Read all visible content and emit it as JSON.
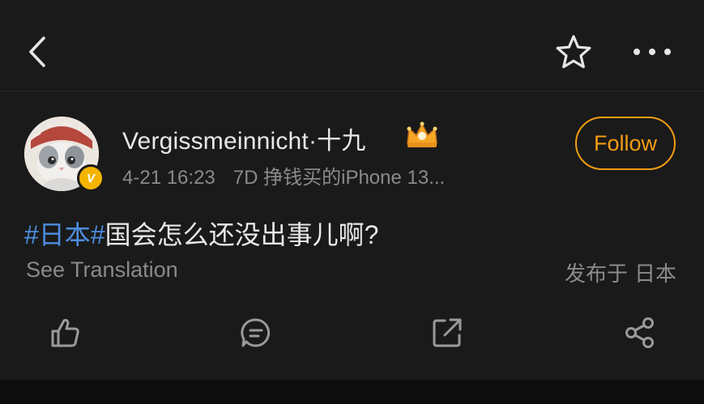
{
  "header": {
    "back_icon": "chevron-left-icon",
    "star_icon": "star-outline-icon",
    "more_icon": "ellipsis-icon"
  },
  "post": {
    "author": {
      "name": "Vergissmeinnicht·十九",
      "verified_badge": "V",
      "crown_badge_icon": "crown-icon",
      "crown_color": "#f5a623",
      "verified_color": "#f5b400"
    },
    "time": "4-21 16:23",
    "source": "7D 挣钱买的iPhone 13...",
    "follow_label": "Follow",
    "follow_color": "#f39c12",
    "text": {
      "hashtag_prefix": "#",
      "topic": "日本",
      "hashtag_suffix": "#",
      "body": "国会怎么还没出事儿啊?",
      "topic_color": "#4d8ee0"
    },
    "translate_label": "See Translation",
    "location_prefix": "发布于",
    "location": "日本"
  },
  "actions": {
    "like_icon": "thumbs-up-icon",
    "comment_icon": "comment-bubble-icon",
    "repost_icon": "external-link-icon",
    "share_icon": "share-icon"
  }
}
